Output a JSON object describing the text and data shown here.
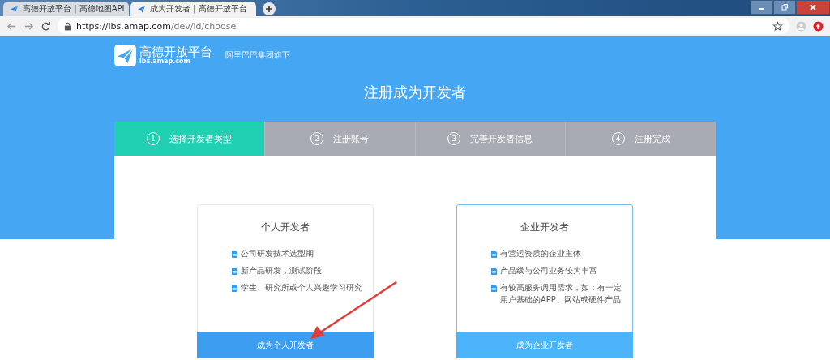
{
  "browser": {
    "tabs": [
      {
        "title": "高德开放平台 | 高德地图API",
        "selected": false
      },
      {
        "title": "成为开发者 | 高德开放平台",
        "selected": true
      }
    ],
    "url": {
      "host": "https://lbs.amap.com",
      "path": "/dev/id/choose"
    }
  },
  "header": {
    "logo": {
      "name": "高德开放平台",
      "domain": "lbs.amap.com"
    },
    "slogan": "阿里巴巴集团旗下",
    "title": "注册成为开发者"
  },
  "steps": [
    {
      "number": "1",
      "label": "选择开发者类型",
      "selected": true
    },
    {
      "number": "2",
      "label": "注册账号",
      "selected": false
    },
    {
      "number": "3",
      "label": "完善开发者信息",
      "selected": false
    },
    {
      "number": "4",
      "label": "注册完成",
      "selected": false
    }
  ],
  "cards": [
    {
      "title": "个人开发者",
      "highlighted": false,
      "items": [
        "公司研发技术选型期",
        "新产品研发，测试阶段",
        "学生、研究所或个人兴趣学习研究"
      ],
      "button": "成为个人开发者"
    },
    {
      "title": "企业开发者",
      "highlighted": true,
      "items": [
        "有营运资质的企业主体",
        "产品线与公司业务较为丰富",
        "有较高服务调用需求，如：有一定用户基础的APP、网站或硬件产品"
      ],
      "button": "成为企业开发者"
    }
  ]
}
